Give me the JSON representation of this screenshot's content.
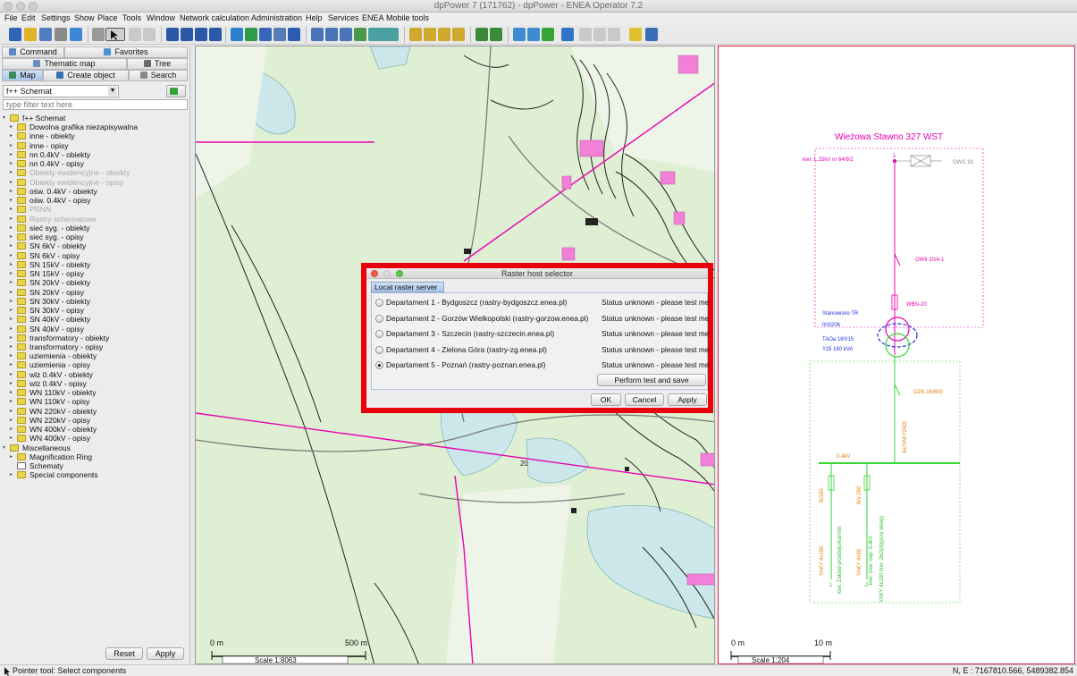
{
  "window": {
    "title": "dpPower 7 (171762) - dpPower - ENEA Operator 7.2"
  },
  "menu": [
    "File",
    "Edit",
    "Settings",
    "Show",
    "Place",
    "Tools",
    "Window",
    "Network calculation",
    "Administration",
    "Help",
    "Services",
    "ENEA",
    "Mobile tools"
  ],
  "left_panel": {
    "tabs_row1": [
      "Command",
      "Favorites"
    ],
    "tabs_row2": [
      "Thematic map",
      "Tree"
    ],
    "tabs_row3": [
      "Map",
      "Create object",
      "Search"
    ],
    "active_tab": "Map",
    "schema_select": "f++ Schemat",
    "filter_placeholder": "type filter text here",
    "tree_root": "f++ Schemat",
    "tree_items": [
      {
        "label": "Dowolna grafika niezapisywalna",
        "grey": false
      },
      {
        "label": "inne - obiekty",
        "grey": false
      },
      {
        "label": "inne - opisy",
        "grey": false
      },
      {
        "label": "nn 0.4kV - obiekty",
        "grey": false
      },
      {
        "label": "nn 0.4kV - opisy",
        "grey": false
      },
      {
        "label": "Obiekty ewidencyjne - obiekty",
        "grey": true
      },
      {
        "label": "Obiekty ewidencyjne - opisy",
        "grey": true
      },
      {
        "label": "ośw. 0.4kV - obiekty",
        "grey": false
      },
      {
        "label": "ośw. 0.4kV - opisy",
        "grey": false
      },
      {
        "label": "PRNN",
        "grey": true
      },
      {
        "label": "Rastry schematowe",
        "grey": true
      },
      {
        "label": "sieć syg. - obiekty",
        "grey": false
      },
      {
        "label": "sieć syg. - opisy",
        "grey": false
      },
      {
        "label": "SN 6kV - obiekty",
        "grey": false
      },
      {
        "label": "SN 6kV - opisy",
        "grey": false
      },
      {
        "label": "SN 15kV - obiekty",
        "grey": false
      },
      {
        "label": "SN 15kV - opisy",
        "grey": false
      },
      {
        "label": "SN 20kV - obiekty",
        "grey": false
      },
      {
        "label": "SN 20kV - opisy",
        "grey": false
      },
      {
        "label": "SN 30kV - obiekty",
        "grey": false
      },
      {
        "label": "SN 30kV - opisy",
        "grey": false
      },
      {
        "label": "SN 40kV - obiekty",
        "grey": false
      },
      {
        "label": "SN 40kV - opisy",
        "grey": false
      },
      {
        "label": "transformatory - obiekty",
        "grey": false
      },
      {
        "label": "transformatory - opisy",
        "grey": false
      },
      {
        "label": "uziemienia - obiekty",
        "grey": false
      },
      {
        "label": "uziemienia - opisy",
        "grey": false
      },
      {
        "label": "wlz 0.4kV - obiekty",
        "grey": false
      },
      {
        "label": "wlz 0.4kV - opisy",
        "grey": false
      },
      {
        "label": "WN 110kV - obiekty",
        "grey": false
      },
      {
        "label": "WN 110kV - opisy",
        "grey": false
      },
      {
        "label": "WN 220kV - obiekty",
        "grey": false
      },
      {
        "label": "WN 220kV - opisy",
        "grey": false
      },
      {
        "label": "WN 400kV - obiekty",
        "grey": false
      },
      {
        "label": "WN 400kV - opisy",
        "grey": false
      }
    ],
    "misc_root": "Miscellaneous",
    "misc_items": [
      "Magnification Ring",
      "Schematy",
      "Special components"
    ],
    "reset_label": "Reset",
    "apply_label": "Apply"
  },
  "map": {
    "scale_label": "Scale 1:8063",
    "scale_start": "0 m",
    "scale_end": "500 m",
    "grid_label": "20"
  },
  "schematic": {
    "title": "Wieżowa Stawno 327 WST",
    "incoming": "kier. L.15kV nr 64/9/2",
    "ows": "OWS 18",
    "owii": "OWII 20/4-1",
    "wbn": "WBN-20",
    "station": "Stanowisko TR",
    "station_no": "000206",
    "trafo1": "TAOa 160/15",
    "trafo2": "Yz5 160 kVA",
    "ozk": "OZK-16/600",
    "cable_in": "4x(YAKY240)",
    "bus": "0.4kV",
    "f1": "B/160",
    "f2": "B/v 250",
    "c1": "YAKY 4x150",
    "c1b": "kier. Zaklad-przeboju/karmin",
    "c2": "YAKY 4x90",
    "c2b": "kier. ośw. nap. 0.4kV",
    "c2c": "YAKY 4x150 kier. 2kO(d)(przy sklep)",
    "n1": "1",
    "n2": "2",
    "scale_label": "Scale 1:204",
    "scale_start": "0 m",
    "scale_end": "10 m"
  },
  "statusbar": {
    "left": "Pointer tool: Select components",
    "right": "N, E : 7167810.566, 5489382.854"
  },
  "dialog": {
    "title": "Raster host selector",
    "tab": "Local raster server",
    "departments": [
      {
        "name": "Departament 1 - Bydgoszcz (rastry-bydgoszcz.enea.pl)",
        "status": "Status unknown - please test me",
        "selected": false
      },
      {
        "name": "Departament 2 - Gorzów Wielkopolski (rastry-gorzow.enea.pl)",
        "status": "Status unknown - please test me",
        "selected": false
      },
      {
        "name": "Departament 3 - Szczecin (rastry-szczecin.enea.pl)",
        "status": "Status unknown - please test me",
        "selected": false
      },
      {
        "name": "Departament 4 - Zielona Góra (rastry-zg.enea.pl)",
        "status": "Status unknown - please test me",
        "selected": false
      },
      {
        "name": "Departament 5 - Poznań (rastry-poznan.enea.pl)",
        "status": "Status unknown - please test me",
        "selected": true
      }
    ],
    "test_button": "Perform test and save",
    "ok": "OK",
    "cancel": "Cancel",
    "apply": "Apply"
  },
  "colors": {
    "highlight_frame": "#e8000d",
    "map_background": "#dfefd3",
    "water": "#cbe7ea",
    "magenta": "#e800b0",
    "green": "#33d633",
    "blue": "#2233dd"
  }
}
